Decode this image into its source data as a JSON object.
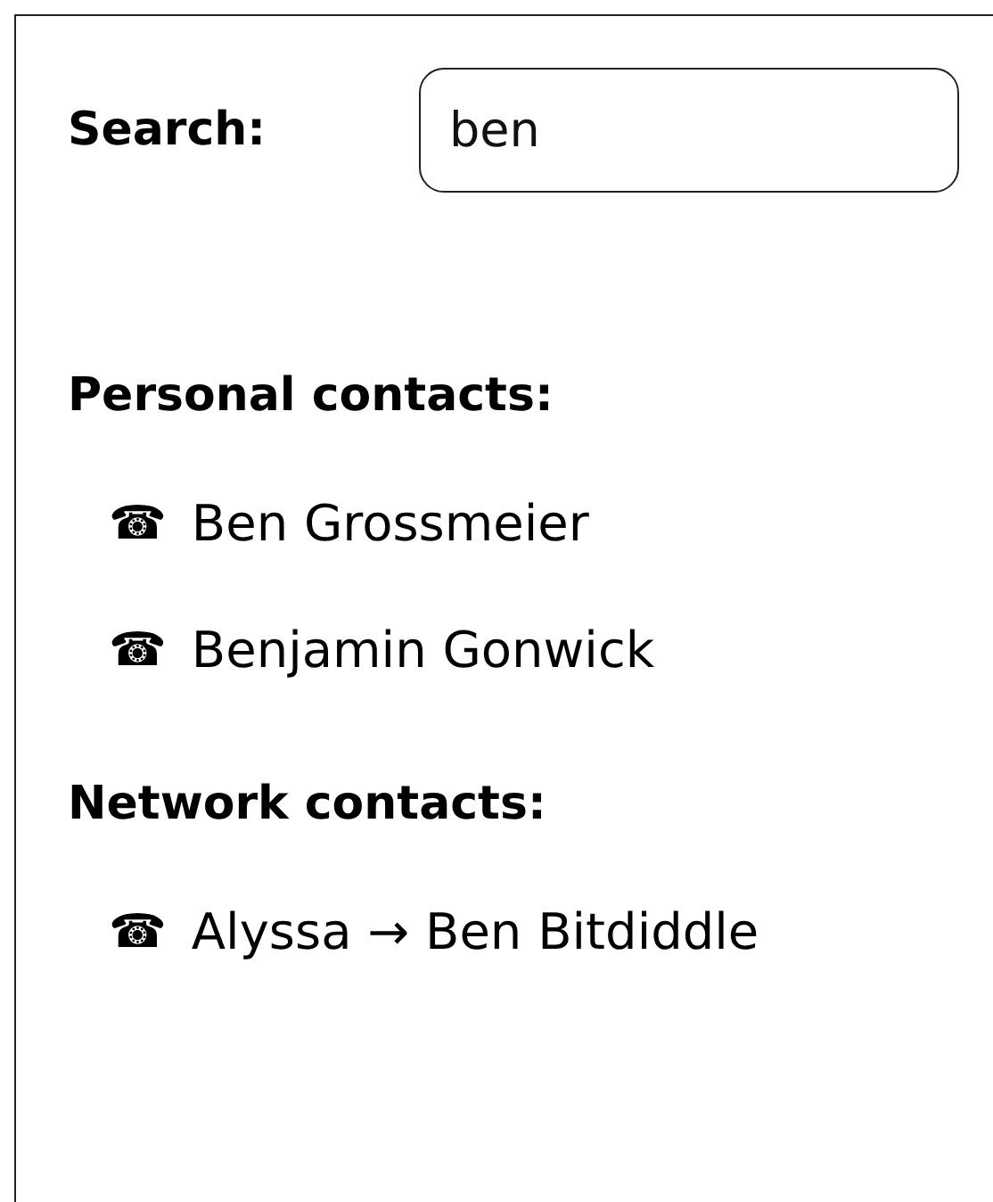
{
  "search": {
    "label": "Search:",
    "value": "ben"
  },
  "sections": [
    {
      "title": "Personal contacts:",
      "contacts": [
        {
          "icon": "☎",
          "name": "Ben Grossmeier"
        },
        {
          "icon": "☎",
          "name": "Benjamin Gonwick"
        }
      ]
    },
    {
      "title": "Network contacts:",
      "contacts": [
        {
          "icon": "☎",
          "name": "Alyssa → Ben Bitdiddle"
        }
      ]
    }
  ]
}
